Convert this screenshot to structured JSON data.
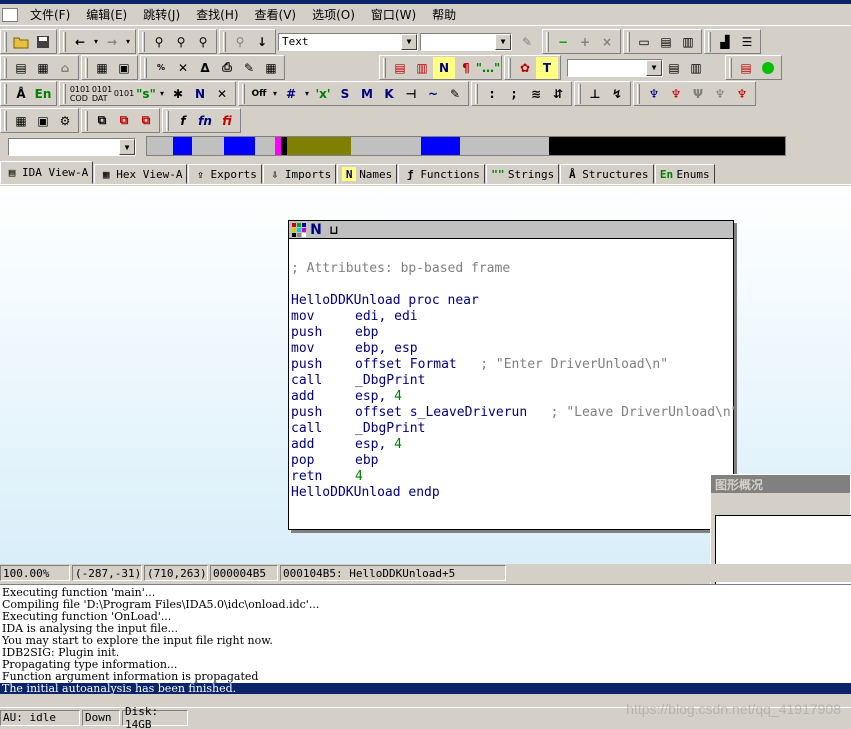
{
  "menu": [
    "文件(F)",
    "编辑(E)",
    "跳转(J)",
    "查找(H)",
    "查看(V)",
    "选项(O)",
    "窗口(W)",
    "帮助"
  ],
  "toolbar": {
    "combo_text": "Text",
    "combo2": "",
    "combo3": "",
    "combo_nav": ""
  },
  "navband": [
    {
      "color": "#c0c0c0",
      "w": 4
    },
    {
      "color": "#0000ff",
      "w": 3
    },
    {
      "color": "#c0c0c0",
      "w": 5
    },
    {
      "color": "#0000ff",
      "w": 5
    },
    {
      "color": "#c0c0c0",
      "w": 3
    },
    {
      "color": "#ff00ff",
      "w": 1
    },
    {
      "color": "#000000",
      "w": 1
    },
    {
      "color": "#808000",
      "w": 10
    },
    {
      "color": "#c0c0c0",
      "w": 11
    },
    {
      "color": "#0000ff",
      "w": 6
    },
    {
      "color": "#c0c0c0",
      "w": 14
    },
    {
      "color": "#000000",
      "w": 37
    }
  ],
  "tabs": [
    {
      "label": "IDA View-A",
      "icon": "ida-view-icon",
      "glyph": "▤"
    },
    {
      "label": "Hex View-A",
      "icon": "hex-view-icon",
      "glyph": "▦"
    },
    {
      "label": "Exports",
      "icon": "exports-icon",
      "glyph": "⇪"
    },
    {
      "label": "Imports",
      "icon": "imports-icon",
      "glyph": "⇩"
    },
    {
      "label": "Names",
      "icon": "names-icon",
      "glyph": "N"
    },
    {
      "label": "Functions",
      "icon": "functions-icon",
      "glyph": "ƒ"
    },
    {
      "label": "Strings",
      "icon": "strings-icon",
      "glyph": "\"\""
    },
    {
      "label": "Structures",
      "icon": "structures-icon",
      "glyph": "Å"
    },
    {
      "label": "Enums",
      "icon": "enums-icon",
      "glyph": "En"
    }
  ],
  "node": {
    "comment": "; Attributes: bp-based frame",
    "lines": [
      {
        "a": "HelloDDKUnload proc near",
        "type": "label"
      },
      {
        "m": "mov",
        "o": "edi, edi"
      },
      {
        "m": "push",
        "o": "ebp"
      },
      {
        "m": "mov",
        "o": "ebp, esp"
      },
      {
        "m": "push",
        "o": "offset Format",
        "c": "; \"Enter DriverUnload\\n\""
      },
      {
        "m": "call",
        "o": "_DbgPrint"
      },
      {
        "m": "add",
        "o": "esp, ",
        "n": "4"
      },
      {
        "m": "push",
        "o": "offset s_LeaveDriverun",
        "c": "; \"Leave DriverUnload\\n\""
      },
      {
        "m": "call",
        "o": "_DbgPrint"
      },
      {
        "m": "add",
        "o": "esp, ",
        "n": "4"
      },
      {
        "m": "pop",
        "o": "ebp"
      },
      {
        "m": "retn",
        "o": "",
        "n": "4"
      },
      {
        "a": "HelloDDKUnload endp",
        "type": "label"
      }
    ]
  },
  "overview": {
    "title": "图形概况"
  },
  "status": {
    "zoom": "100.00%",
    "coord1": "(-287,-31)",
    "coord2": "(710,263)",
    "offset": "000004B5",
    "location": "000104B5: HelloDDKUnload+5"
  },
  "output": [
    "Executing function 'main'...",
    "Compiling file 'D:\\Program Files\\IDA5.0\\idc\\onload.idc'...",
    "Executing function 'OnLoad'...",
    "IDA is analysing the input file...",
    "You may start to explore the input file right now.",
    "IDB2SIG: Plugin init.",
    "Propagating type information...",
    "Function argument information is propagated",
    "The initial autoanalysis has been finished."
  ],
  "bottom": {
    "au": "AU:  idle",
    "dir": "Down",
    "disk": "Disk: 14GB"
  },
  "watermark": "https://blog.csdn.net/qq_41917908"
}
